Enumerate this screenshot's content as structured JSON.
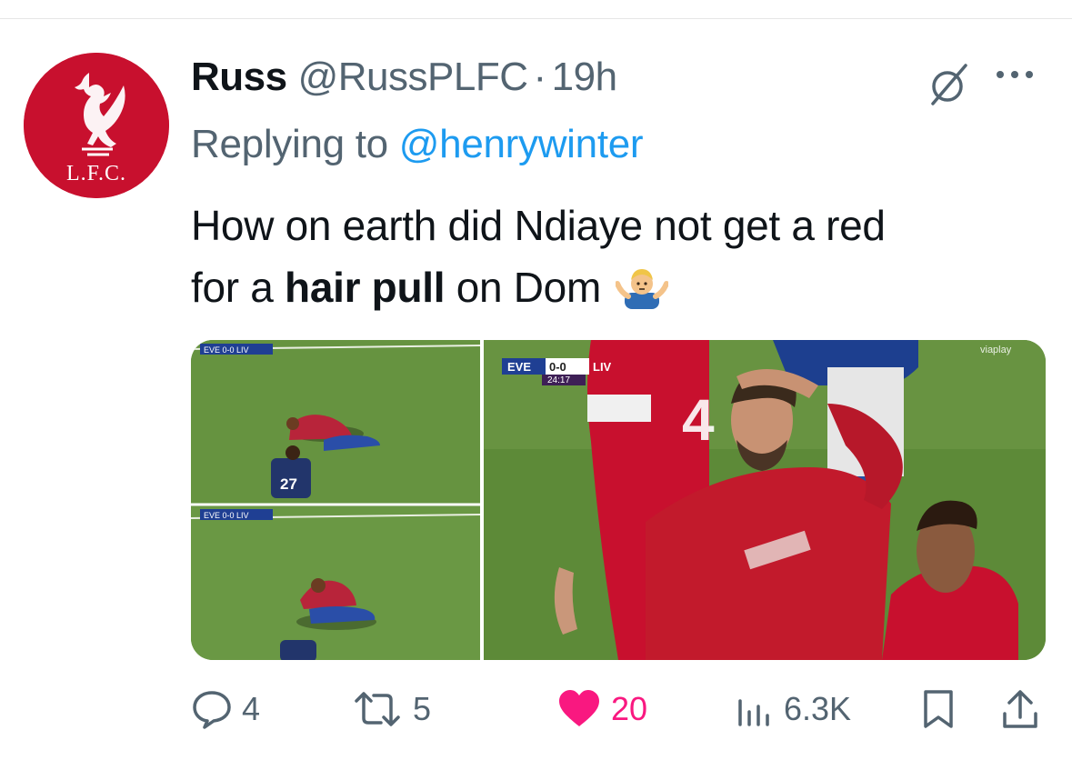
{
  "author": {
    "name": "Russ",
    "handle": "@RussPLFC",
    "separator": "·",
    "time": "19h",
    "avatar_text": "L.F.C."
  },
  "reply": {
    "prefix": "Replying to",
    "handle": "@henrywinter"
  },
  "tweet": {
    "line1": "How on earth did Ndiaye not get a red",
    "line2_prefix": "for a",
    "line2_bold": "hair pull",
    "line2_suffix": "on Dom"
  },
  "media": {
    "left_score_top": "EVE 0-0 LIV",
    "left_score_bottom": "EVE 0-0 LIV",
    "player_number": "27",
    "score_home": "EVE",
    "score_value": "0-0",
    "score_away": "LIV",
    "match_clock": "24:17",
    "broadcaster": "viaplay",
    "shirt_number": "4"
  },
  "actions": {
    "replies": "4",
    "retweets": "5",
    "likes": "20",
    "views": "6.3K"
  },
  "colors": {
    "accent": "#1d9bf0",
    "like": "#f91880",
    "muted": "#536471",
    "lfc_red": "#c8102e"
  },
  "icons": [
    "reply-icon",
    "retweet-icon",
    "like-icon",
    "views-icon",
    "bookmark-icon",
    "share-icon",
    "grok-icon",
    "more-icon",
    "shrug-emoji"
  ]
}
